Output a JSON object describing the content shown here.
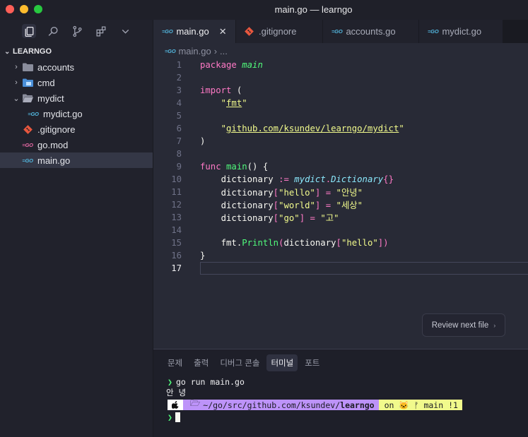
{
  "window": {
    "title": "main.go — learngo"
  },
  "activity_bar": {
    "icons": [
      "explorer-icon",
      "search-icon",
      "source-control-icon",
      "extensions-icon",
      "chevron-down-icon"
    ]
  },
  "explorer": {
    "root": "LEARNGO",
    "items": [
      {
        "label": "accounts",
        "kind": "folder",
        "expanded": false
      },
      {
        "label": "cmd",
        "kind": "folder",
        "expanded": false
      },
      {
        "label": "mydict",
        "kind": "folder",
        "expanded": true
      },
      {
        "label": "mydict.go",
        "kind": "go-file"
      },
      {
        "label": ".gitignore",
        "kind": "git-file"
      },
      {
        "label": "go.mod",
        "kind": "go-mod-file"
      },
      {
        "label": "main.go",
        "kind": "go-file",
        "selected": true
      }
    ]
  },
  "tabs": [
    {
      "label": "main.go",
      "icon_text": "GO",
      "active": true
    },
    {
      "label": ".gitignore",
      "icon": "git-icon"
    },
    {
      "label": "accounts.go",
      "icon_text": "GO"
    },
    {
      "label": "mydict.go",
      "icon_text": "GO"
    }
  ],
  "tab_close_glyph": "✕",
  "breadcrumb": {
    "icon_text": "GO",
    "file": "main.go",
    "separator": "›",
    "more": "..."
  },
  "code": {
    "line_numbers": [
      "1",
      "2",
      "3",
      "4",
      "5",
      "6",
      "7",
      "8",
      "9",
      "10",
      "11",
      "12",
      "13",
      "14",
      "15",
      "16",
      "17"
    ],
    "current_line": "17",
    "tokens": {
      "l1_kw": "package",
      "l1_name": "main",
      "l3_kw": "import",
      "l3_paren": "(",
      "l4_str": "fmt",
      "l6_str": "github.com/ksundev/learngo/mydict",
      "l7": ")",
      "l9_kw": "func",
      "l9_fn": "main",
      "l9_rest": "() {",
      "l10_var": "dictionary",
      "l10_op": ":=",
      "l10_pkg": "mydict",
      "l10_type": "Dictionary",
      "l10_braces": "{}",
      "l11_var": "dictionary",
      "l11_key": "hello",
      "l11_val": "안녕",
      "l12_var": "dictionary",
      "l12_key": "world",
      "l12_val": "세상",
      "l13_var": "dictionary",
      "l13_key": "go",
      "l13_val": "고",
      "l15_pkg": "fmt",
      "l15_fn": "Println",
      "l15_arg": "dictionary",
      "l15_key": "hello",
      "l16": "}"
    }
  },
  "review_button": {
    "label": "Review next file",
    "arrow": "›"
  },
  "panel": {
    "tabs": [
      {
        "label": "문제"
      },
      {
        "label": "출력"
      },
      {
        "label": "디버그 콘솔"
      },
      {
        "label": "터미널",
        "active": true
      },
      {
        "label": "포트"
      }
    ]
  },
  "terminal": {
    "prompt_glyph": "❯",
    "command": "go run main.go",
    "output": "안 녕",
    "path_prefix": "~/go/src/github.com/ksundev/",
    "path_bold": "learngo",
    "git_info": "on 🐱 ᚠ main !1",
    "folder_glyph": "🗁"
  },
  "colors": {
    "accent_green": "#50fa7b",
    "keyword_pink": "#ff79c6",
    "string_yellow": "#f1fa8c",
    "type_cyan": "#8be9fd",
    "purple": "#bd93f9"
  }
}
